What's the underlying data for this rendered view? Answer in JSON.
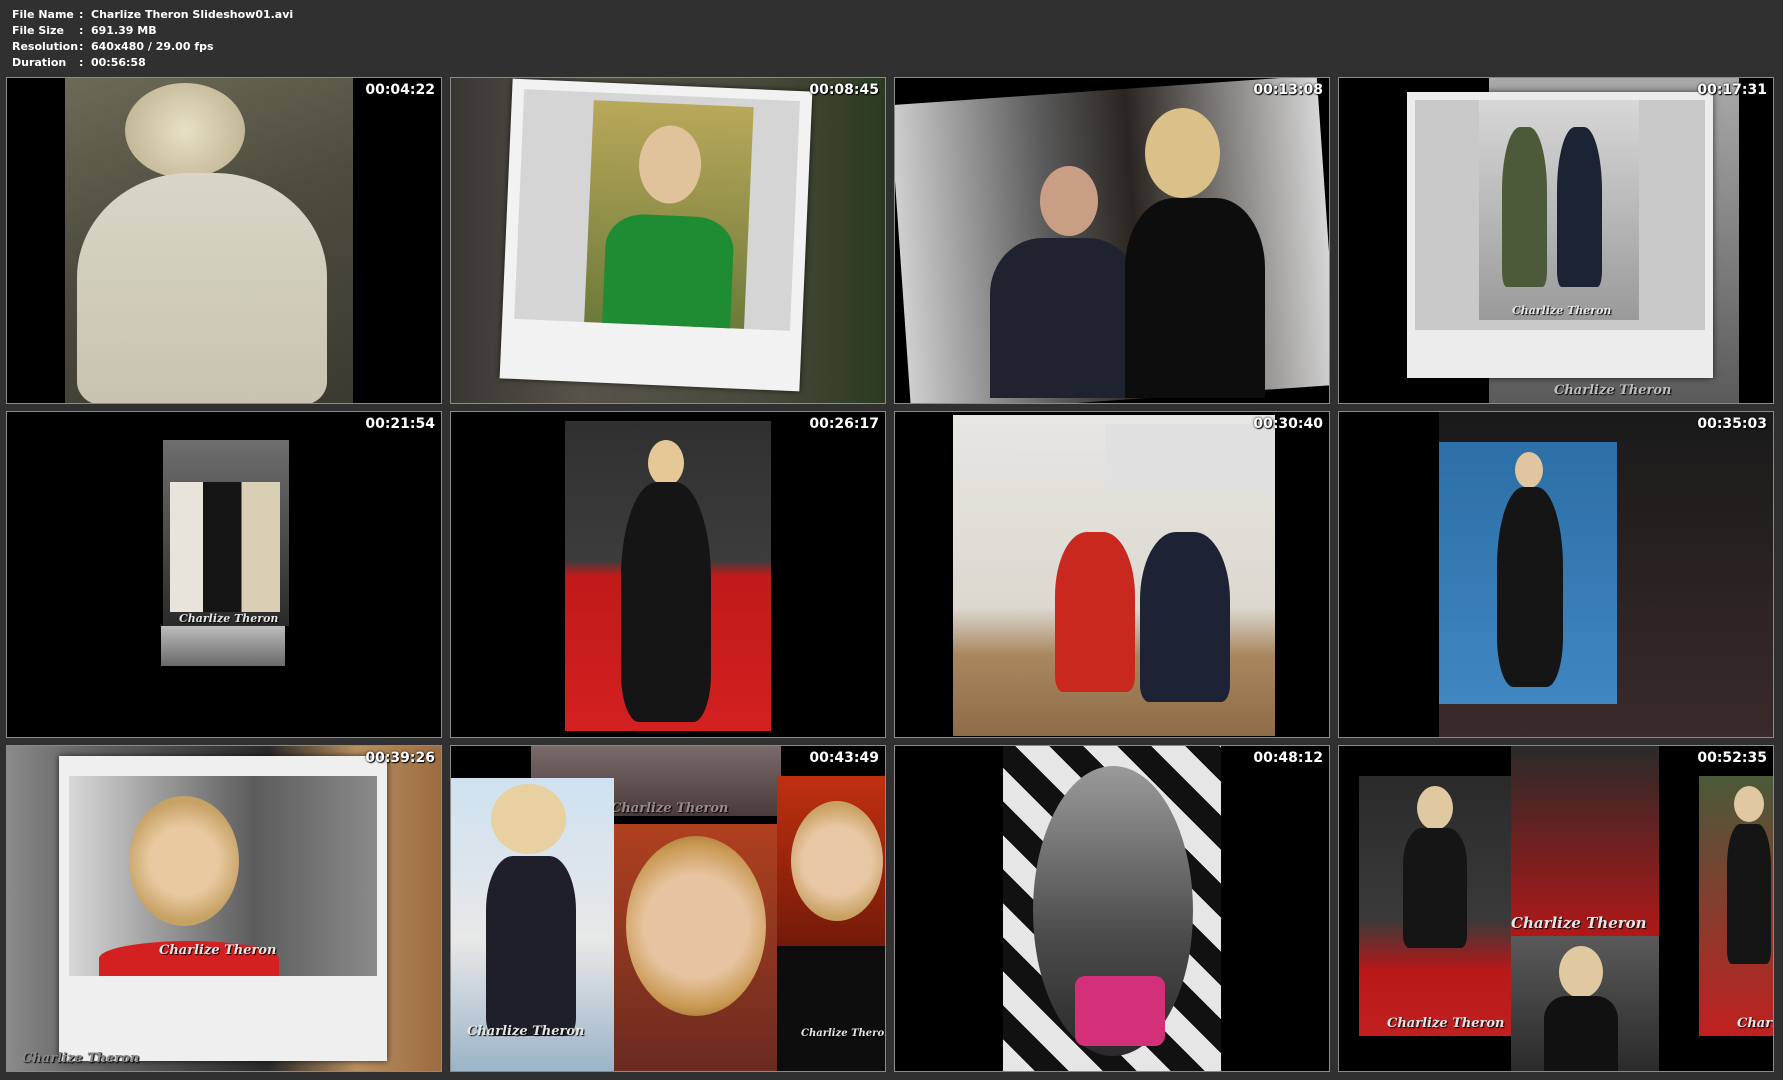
{
  "file_info": {
    "rows": [
      {
        "label": "File Name",
        "value": "Charlize Theron Slideshow01.avi"
      },
      {
        "label": "File Size",
        "value": "691.39 MB"
      },
      {
        "label": "Resolution",
        "value": "640x480 / 29.00 fps"
      },
      {
        "label": "Duration",
        "value": "00:56:58"
      }
    ],
    "separator": ":"
  },
  "thumbnails": [
    {
      "time": "00:04:22"
    },
    {
      "time": "00:08:45"
    },
    {
      "time": "00:13:08"
    },
    {
      "time": "00:17:31"
    },
    {
      "time": "00:21:54"
    },
    {
      "time": "00:26:17"
    },
    {
      "time": "00:30:40"
    },
    {
      "time": "00:35:03"
    },
    {
      "time": "00:39:26"
    },
    {
      "time": "00:43:49"
    },
    {
      "time": "00:48:12"
    },
    {
      "time": "00:52:35"
    }
  ],
  "watermark": "Charlize Theron"
}
